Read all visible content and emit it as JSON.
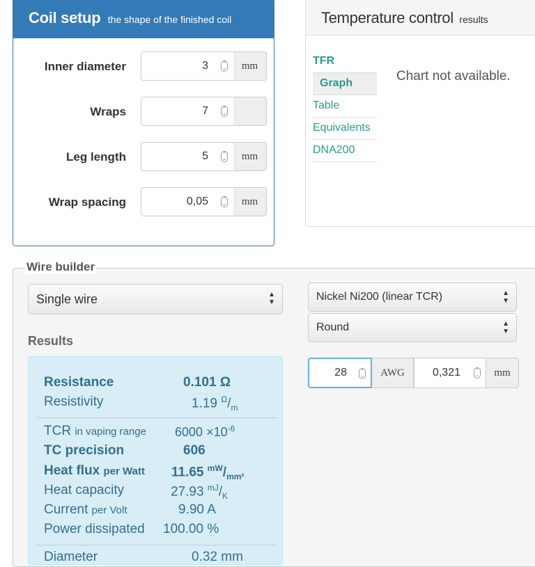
{
  "coil_setup": {
    "title": "Coil setup",
    "subtitle": "the shape of the finished coil",
    "fields": [
      {
        "label": "Inner diameter",
        "value": "3",
        "unit": "mm"
      },
      {
        "label": "Wraps",
        "value": "7",
        "unit": ""
      },
      {
        "label": "Leg length",
        "value": "5",
        "unit": "mm"
      },
      {
        "label": "Wrap spacing",
        "value": "0,05",
        "unit": "mm"
      }
    ]
  },
  "temperature_control": {
    "title": "Temperature control",
    "subtitle": "results",
    "tabs": [
      "TFR",
      "Graph",
      "Table",
      "Equivalents",
      "DNA200"
    ],
    "active_tab": "Graph",
    "chart_message": "Chart not available."
  },
  "wire_builder": {
    "legend": "Wire builder",
    "wire_type": "Single wire",
    "material": "Nickel Ni200 (linear TCR)",
    "shape": "Round",
    "awg_value": "28",
    "awg_unit": "AWG",
    "mm_value": "0,321",
    "mm_unit": "mm"
  },
  "results": {
    "label": "Results",
    "resistance": {
      "label": "Resistance",
      "value": "0.101",
      "unit": "Ω"
    },
    "resistivity": {
      "label": "Resistivity",
      "value": "1.19",
      "unit_num": "Ω",
      "unit_den": "m"
    },
    "tcr": {
      "label": "TCR",
      "label_small": "in vaping range",
      "value": "6000",
      "unit": "×10",
      "unit_exp": "-6"
    },
    "tc_precision": {
      "label": "TC precision",
      "value": "606"
    },
    "heat_flux": {
      "label": "Heat flux",
      "label_small": "per Watt",
      "value": "11.65",
      "unit_num": "mW",
      "unit_den": "mm²"
    },
    "heat_capacity": {
      "label": "Heat capacity",
      "value": "27.93",
      "unit_num": "mJ",
      "unit_den": "K"
    },
    "current": {
      "label": "Current",
      "label_small": "per Volt",
      "value": "9.90",
      "unit": "A"
    },
    "power": {
      "label": "Power dissipated",
      "value": "100.00",
      "unit": "%"
    },
    "diameter": {
      "label": "Diameter",
      "value": "0.32",
      "unit": "mm"
    }
  },
  "colors": {
    "primary": "#337ab7",
    "tab_link": "#2a9c8e",
    "results_bg": "#d9edf7",
    "results_text": "#31708f"
  }
}
